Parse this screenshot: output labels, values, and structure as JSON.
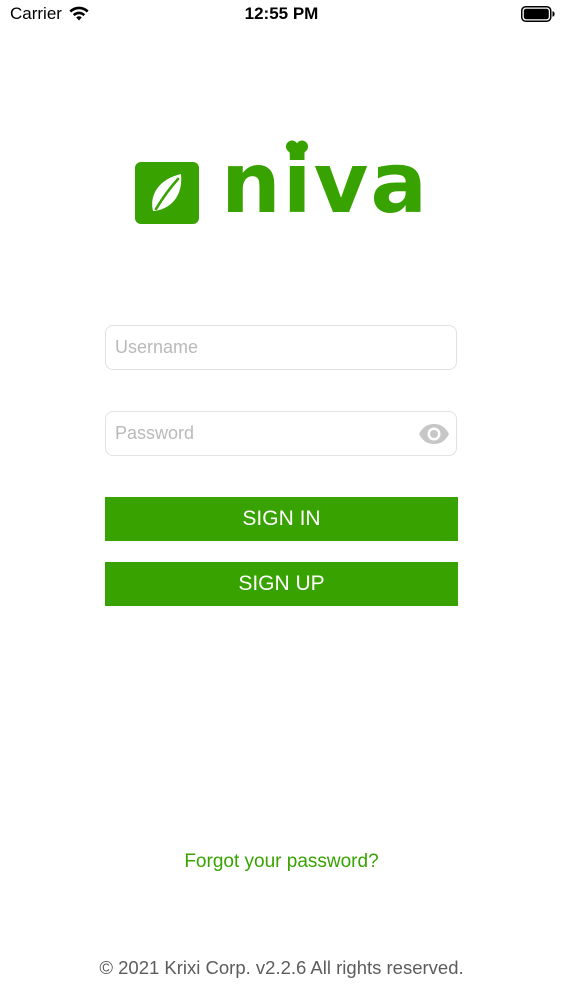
{
  "status_bar": {
    "carrier": "Carrier",
    "time": "12:55 PM",
    "wifi_icon": "wifi-icon",
    "battery_icon": "battery-full-icon"
  },
  "logo": {
    "wordmark": "niva",
    "mark_icon": "leaf-icon",
    "accent_icon": "heart-icon"
  },
  "form": {
    "username": {
      "value": "",
      "placeholder": "Username"
    },
    "password": {
      "value": "",
      "placeholder": "Password",
      "toggle_icon": "eye-icon"
    },
    "sign_in_label": "SIGN IN",
    "sign_up_label": "SIGN UP"
  },
  "forgot_password": "Forgot your password?",
  "footer": "© 2021 Krixi Corp. v2.2.6 All rights reserved.",
  "colors": {
    "brand": "#38a300",
    "button_text": "#ffffff",
    "input_border": "#e2e2e2",
    "placeholder": "#b9b9b9",
    "footer_text": "#5c5c5c"
  }
}
